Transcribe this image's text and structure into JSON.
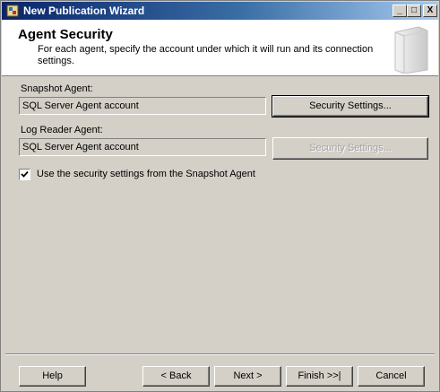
{
  "window": {
    "title": "New Publication Wizard",
    "minimize_glyph": "_",
    "maximize_glyph": "□",
    "close_glyph": "X"
  },
  "header": {
    "title": "Agent Security",
    "description": "For each agent, specify the account under which it will run and its connection settings."
  },
  "snapshot_agent": {
    "label": "Snapshot Agent:",
    "account": "SQL Server Agent account",
    "button_label": "Security Settings..."
  },
  "log_reader_agent": {
    "label": "Log Reader Agent:",
    "account": "SQL Server Agent account",
    "button_label": "Security Settings...",
    "button_enabled": false
  },
  "use_snapshot_settings": {
    "label": "Use the security settings from the Snapshot Agent",
    "checked": true
  },
  "footer": {
    "help_label": "Help",
    "back_label": "< Back",
    "next_label": "Next >",
    "finish_label": "Finish >>|",
    "cancel_label": "Cancel"
  },
  "colors": {
    "titlebar_start": "#0a246a",
    "titlebar_end": "#a6caf0",
    "face": "#d4d0c8"
  }
}
